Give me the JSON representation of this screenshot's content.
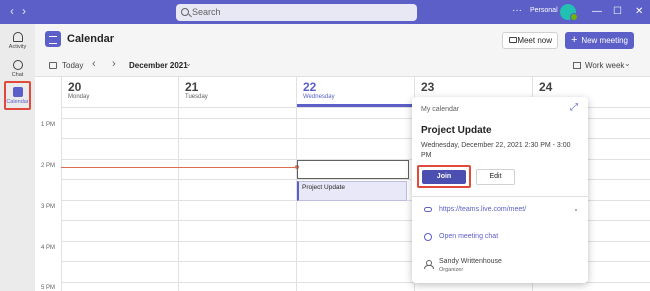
{
  "titlebar": {
    "search_placeholder": "Search",
    "more": "···",
    "account": "Personal",
    "minimize": "—",
    "maximize": "☐",
    "close": "✕"
  },
  "rail": {
    "activity": "Activity",
    "chat": "Chat",
    "calendar": "Calendar"
  },
  "header": {
    "title": "Calendar",
    "meet_now": "Meet now",
    "new_meeting": "New meeting"
  },
  "toolbar": {
    "today": "Today",
    "month": "December 2021",
    "view": "Work week"
  },
  "days": [
    {
      "num": "20",
      "name": "Monday"
    },
    {
      "num": "21",
      "name": "Tuesday"
    },
    {
      "num": "22",
      "name": "Wednesday"
    },
    {
      "num": "23",
      "name": ""
    },
    {
      "num": "24",
      "name": ""
    }
  ],
  "hours": [
    "1 PM",
    "2 PM",
    "3 PM",
    "4 PM",
    "5 PM"
  ],
  "event": {
    "title": "Project Update"
  },
  "popup": {
    "calendar": "My calendar",
    "title": "Project Update",
    "datetime": "Wednesday, December 22, 2021 2:30 PM - 3:00 PM",
    "join": "Join",
    "edit": "Edit",
    "link": "https://teams.live.com/meet/",
    "chat": "Open meeting chat",
    "organizer_name": "Sandy Writtenhouse",
    "organizer_role": "Organizer"
  }
}
